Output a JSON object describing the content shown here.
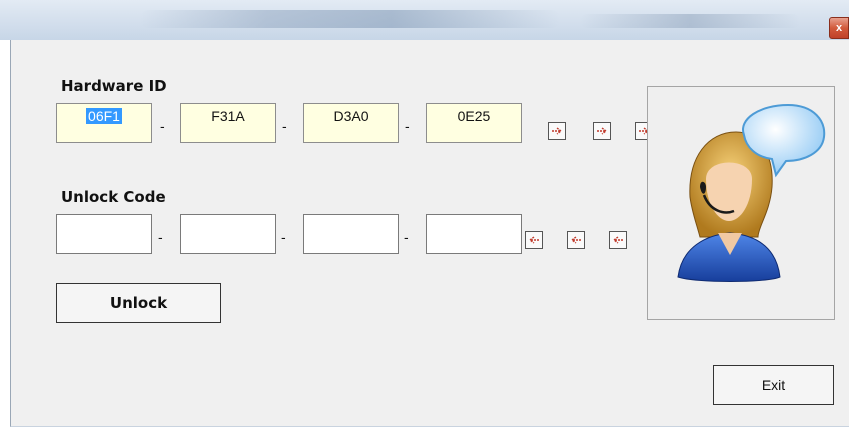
{
  "window": {
    "close_glyph": "x"
  },
  "hardware": {
    "label": "Hardware ID",
    "fields": [
      "06F1",
      "F31A",
      "D3A0",
      "0E25"
    ],
    "separators": [
      "-",
      "-",
      "-"
    ],
    "copy_arrow_icon": "arrow-right-icon"
  },
  "unlock": {
    "label": "Unlock Code",
    "fields": [
      "",
      "",
      "",
      ""
    ],
    "separators": [
      "-",
      "-",
      "-"
    ],
    "paste_arrow_icon": "arrow-left-icon"
  },
  "buttons": {
    "unlock": "Unlock",
    "exit": "Exit"
  },
  "image": {
    "icon": "support-agent-icon"
  }
}
